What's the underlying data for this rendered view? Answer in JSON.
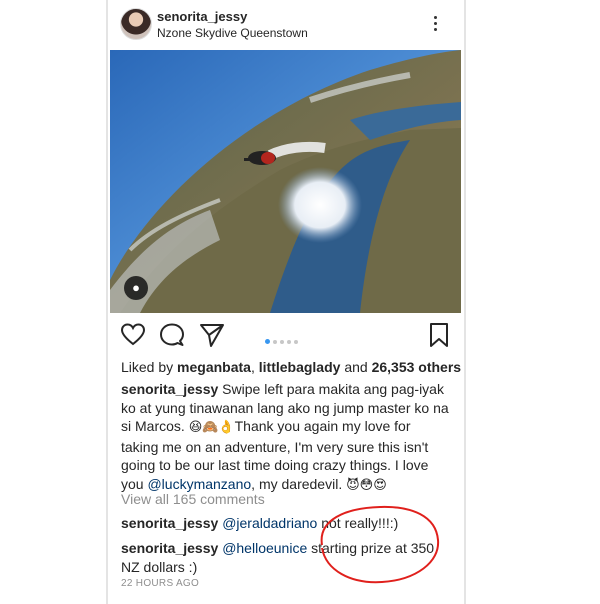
{
  "post": {
    "username": "senorita_jessy",
    "location": "Nzone Skydive Queenstown",
    "image_alt": "Skydiver in freefall above lake and mountains"
  },
  "carousel": {
    "count": 5,
    "active_index": 0
  },
  "likes": {
    "prefix": "Liked by ",
    "user1": "meganbata",
    "separator": ", ",
    "user2": "littlebaglady",
    "and": " and ",
    "count": "26,353 others"
  },
  "caption": {
    "username": "senorita_jessy",
    "text1": " Swipe left para makita ang pag-iyak ko at yung tinawanan lang ako ng jump master ko na si Marcos. ",
    "emoji1": "😆🙈👌",
    "text2": "Thank you again my love for taking me on an adventure, I'm very sure this isn't going to be our last time doing crazy things. I love you ",
    "mention": "@luckymanzano",
    "text3": ", my daredevil. ",
    "emoji2": "😈😳😍"
  },
  "view_all": "View all 165 comments",
  "comments": [
    {
      "username": "senorita_jessy",
      "mention": "@jeraldadriano",
      "text": "  not really!!!:)"
    },
    {
      "username": "senorita_jessy",
      "mention": "@helloeunice",
      "text": " starting prize at 350 NZ dollars :)"
    }
  ],
  "timestamp": "22 HOURS AGO",
  "colors": {
    "text": "#262626",
    "muted": "#8e8e8e",
    "mention": "#003569",
    "dot_active": "#3897f0",
    "annotation": "#e0201c"
  },
  "icons": [
    "heart-icon",
    "comment-icon",
    "share-icon",
    "bookmark-icon",
    "more-icon",
    "user-tag-icon"
  ]
}
